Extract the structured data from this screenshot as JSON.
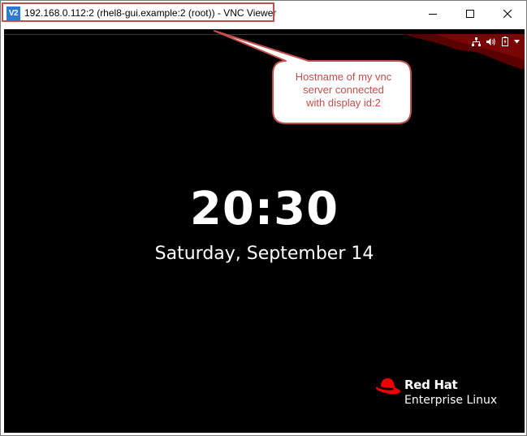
{
  "window": {
    "title": "192.168.0.112:2 (rhel8-gui.example:2 (root)) - VNC Viewer",
    "app_icon_text": "V2",
    "controls": {
      "minimize": "minimize-icon",
      "maximize": "maximize-icon",
      "close": "close-icon"
    }
  },
  "tray": {
    "icons": [
      "network-icon",
      "volume-icon",
      "battery-icon",
      "chevron-down-icon"
    ]
  },
  "lockscreen": {
    "time": "20:30",
    "date": "Saturday, September 14"
  },
  "branding": {
    "line1": "Red Hat",
    "line2": "Enterprise Linux",
    "logo": "red-hat-logo-icon"
  },
  "callout": {
    "line1": "Hostname of my vnc",
    "line2": "server connected",
    "line3": "with display id:2"
  },
  "colors": {
    "annotation": "#c0504d",
    "desktop_bg": "#000000",
    "accent_red": "#ee0000",
    "app_icon": "#2d7bd1"
  }
}
